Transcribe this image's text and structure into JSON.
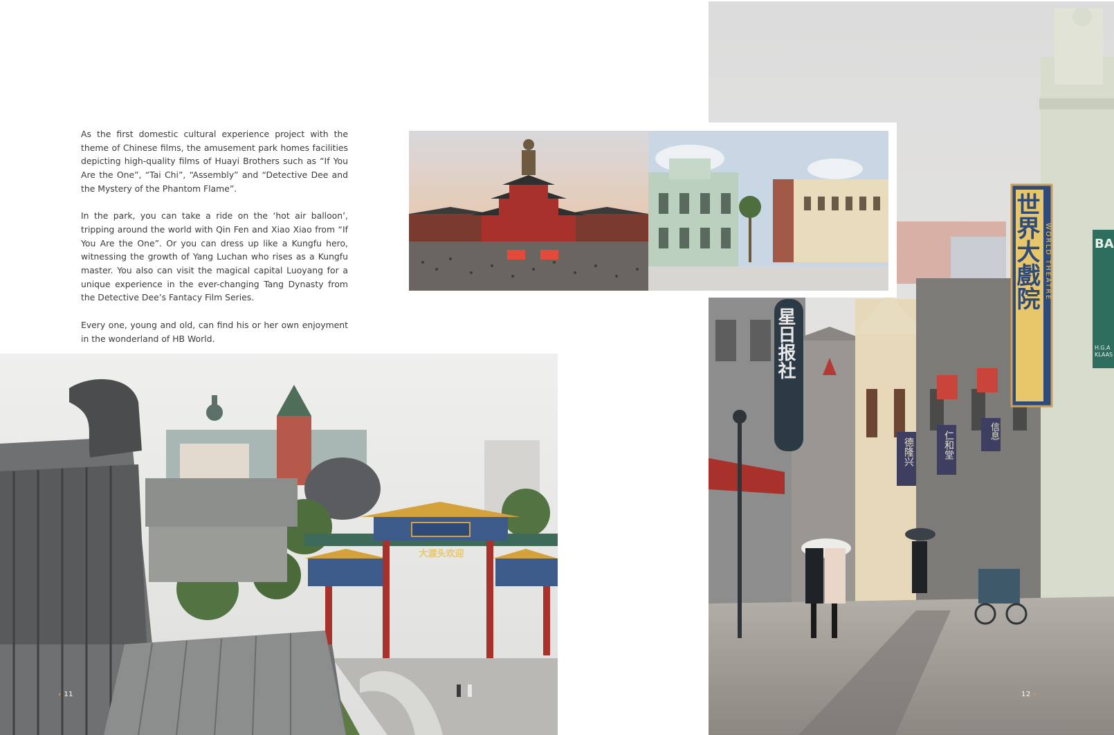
{
  "article": {
    "paragraphs": [
      "As the first domestic cultural experience project with the theme of Chinese films, the amusement park homes facilities depicting high-quality films of Huayi Brothers such as “If You Are the One”, “Tai Chi”, “Assembly” and “Detective Dee and the Mystery of the Phantom Flame”.",
      "In the park, you can take a ride on the ‘hot air balloon’, tripping around the world with Qin Fen and Xiao Xiao from “If You Are the One”. Or you can dress up like a Kungfu hero, witnessing the growth of Yang Luchan who rises as a Kungfu master. You also can visit the magical capital Luoyang for a unique experience in the ever-changing Tang Dynasty from the Detective Dee’s Fantacy Film Series.",
      "Every one, young and old, can find his or her own enjoyment in the wonderland of HB World."
    ]
  },
  "photos": {
    "gate": {
      "sign": "大渡头欢迎"
    },
    "street": {
      "theatre_sign_cn": "世界大戲院",
      "theatre_sign_en": "WORLD THEATRE",
      "newspaper_sign": "星日报社",
      "banner_1": "德隆兴",
      "banner_2": "仁和堂",
      "banner_3": "信息",
      "store_sign": "BA",
      "store_sub": "H.G.A KLAAS"
    }
  },
  "pages": {
    "left_number": "11",
    "right_number": "12"
  },
  "colors": {
    "text": "#3a3a3a",
    "accent": "#e8a23a",
    "sign_blue": "#2e4a7a",
    "roof_gold": "#d4a23c",
    "temple_red": "#a8322b"
  }
}
